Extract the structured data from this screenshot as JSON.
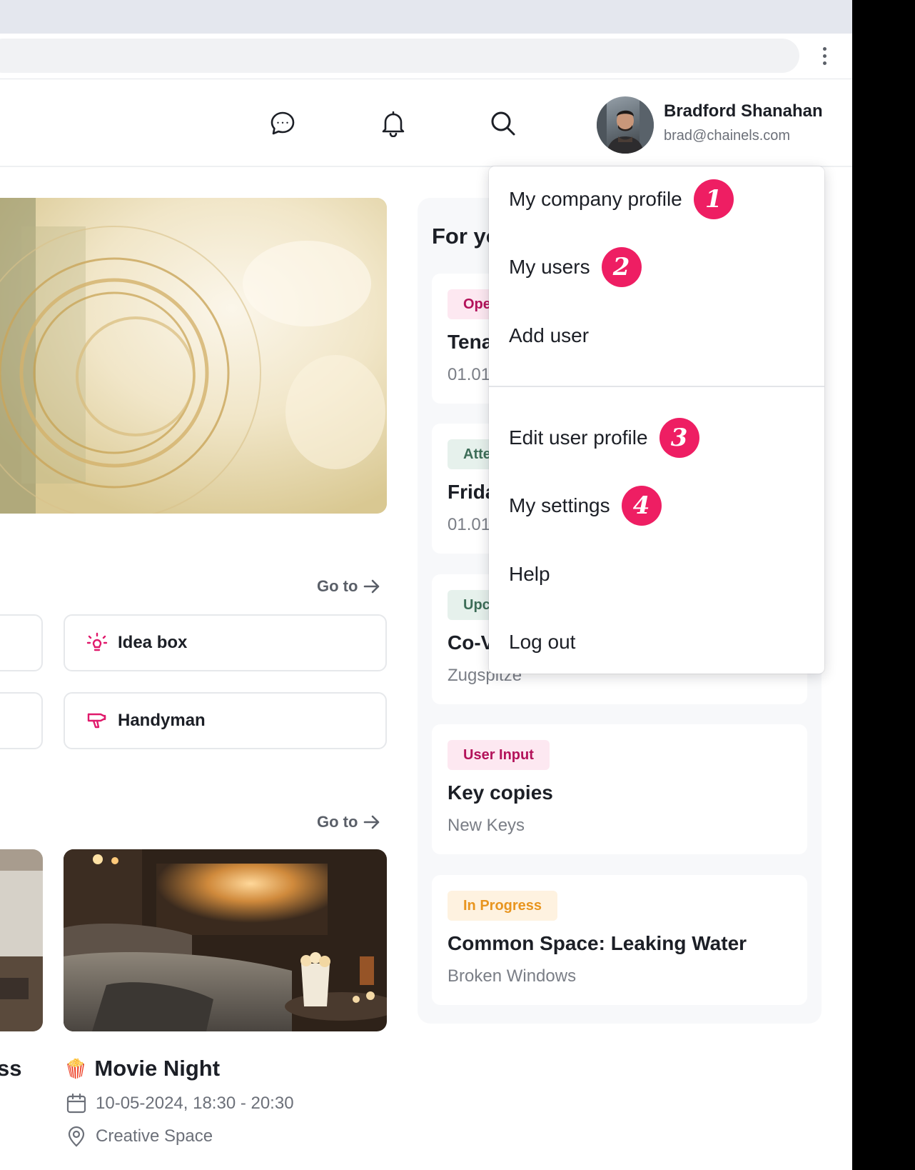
{
  "header": {
    "user_name": "Bradford Shanahan",
    "user_email": "brad@chainels.com"
  },
  "links": {
    "goto_1": "Go to",
    "goto_2": "Go to"
  },
  "quick_actions": [
    {
      "label": "Idea box",
      "icon": "lightbulb-icon"
    },
    {
      "label": "Handyman",
      "icon": "hairdryer-icon"
    }
  ],
  "events": {
    "partial_title": "ss",
    "event": {
      "emoji": "🍿",
      "title": "Movie Night",
      "date": "10-05-2024, 18:30 - 20:30",
      "location": "Creative Space"
    }
  },
  "for_you": {
    "title": "For yo",
    "cards": [
      {
        "badge": "Ope",
        "title": "Tena",
        "subtitle": "01.01"
      },
      {
        "badge": "Atte",
        "title": "Frida",
        "subtitle": "01.01"
      },
      {
        "badge": "Upc",
        "title": "Co-V",
        "subtitle": "Zugspitze"
      },
      {
        "badge": "User Input",
        "title": "Key copies",
        "subtitle": "New Keys"
      },
      {
        "badge": "In Progress",
        "title": "Common Space: Leaking Water",
        "subtitle": "Broken Windows"
      }
    ]
  },
  "menu": {
    "items": [
      {
        "label": "My company profile",
        "step": "1"
      },
      {
        "label": "My users",
        "step": "2"
      },
      {
        "label": "Add user",
        "step": ""
      },
      {
        "label": "Edit user profile",
        "step": "3"
      },
      {
        "label": "My settings",
        "step": "4"
      },
      {
        "label": "Help",
        "step": ""
      },
      {
        "label": "Log out",
        "step": ""
      }
    ]
  },
  "colors": {
    "accent_pink": "#ee1e63",
    "badge_pink_bg": "#fde8f1",
    "badge_pink_fg": "#b3125a",
    "badge_green_bg": "#e6f1ec",
    "badge_green_fg": "#3d6d58",
    "badge_orange_bg": "#fef2e0",
    "badge_orange_fg": "#e8951f"
  }
}
